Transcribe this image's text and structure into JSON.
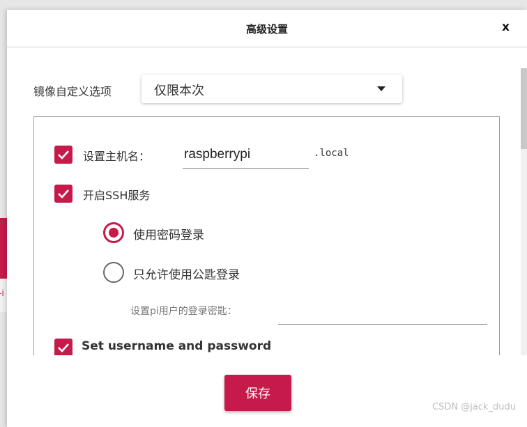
{
  "dialog": {
    "title": "高级设置",
    "close_label": "x",
    "save_label": "保存"
  },
  "background_app": {
    "partial_text": "-i"
  },
  "image_customization": {
    "label": "镜像自定义选项",
    "selected": "仅限本次"
  },
  "settings": {
    "hostname": {
      "checked": true,
      "label": "设置主机名：",
      "value": "raspberrypi",
      "suffix": ".local"
    },
    "ssh": {
      "checked": true,
      "label": "开启SSH服务",
      "options": [
        {
          "label": "使用密码登录",
          "selected": true
        },
        {
          "label": "只允许使用公匙登录",
          "selected": false
        }
      ],
      "password_label": "设置pi用户的登录密匙："
    },
    "user": {
      "checked": true,
      "label": "Set username and password"
    }
  },
  "watermark": "CSDN @jack_dudu",
  "colors": {
    "accent": "#c51a4a",
    "border": "#9a9a9a"
  }
}
